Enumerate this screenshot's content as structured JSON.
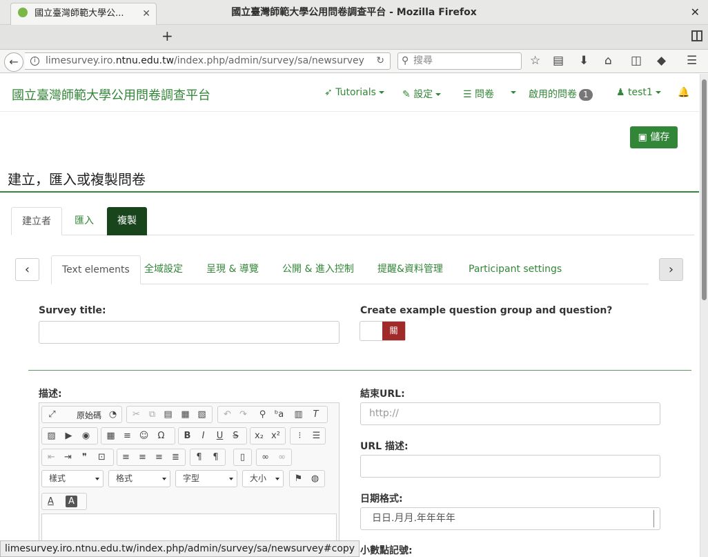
{
  "window": {
    "title": "國立臺灣師範大學公用問卷調查平台 - Mozilla Firefox"
  },
  "browser": {
    "tab_title": "國立臺灣師範大學公...",
    "url_prefix": "limesurvey.iro.",
    "url_host": "ntnu.edu.tw",
    "url_path": "/index.php/admin/survey/sa/newsurvey",
    "search_placeholder": "搜尋",
    "status_url": "limesurvey.iro.ntnu.edu.tw/index.php/admin/survey/sa/newsurvey#copy"
  },
  "app": {
    "brand": "國立臺灣師範大學公用問卷調查平台",
    "menu": {
      "tutorials": "Tutorials",
      "settings": "設定",
      "surveys": "問卷",
      "active_surveys": "啟用的問卷",
      "active_count": "1",
      "user": "test1"
    },
    "save_label": "儲存"
  },
  "page": {
    "title": "建立，匯入或複製問卷",
    "main_tabs": [
      "建立者",
      "匯入",
      "複製"
    ],
    "sub_tabs": [
      "Text elements",
      "全域設定",
      "呈現 & 導覽",
      "公開 & 進入控制",
      "提醒&資料管理",
      "Participant settings"
    ]
  },
  "form": {
    "survey_title_label": "Survey title:",
    "example_label": "Create example question group and question?",
    "example_toggle": "關",
    "description_label": "描述:",
    "end_url_label": "結束URL:",
    "end_url_placeholder": "http://",
    "url_desc_label": "URL 描述:",
    "date_format_label": "日期格式:",
    "date_format_value": "日日.月月.年年年年",
    "decimal_label": "小數點記號:"
  },
  "editor": {
    "source": "原始碼",
    "style_combo": "樣式",
    "format_combo": "格式",
    "font_combo": "字型",
    "size_combo": "大小"
  }
}
